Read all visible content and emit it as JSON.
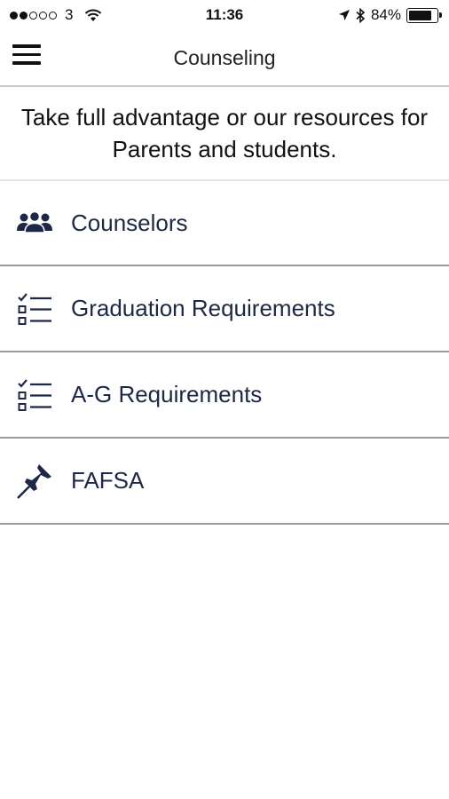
{
  "status_bar": {
    "carrier": "3",
    "time": "11:36",
    "battery": "84%",
    "battery_level": 0.84,
    "signal_bars_filled": 2,
    "signal_bars_total": 5
  },
  "nav": {
    "title": "Counseling",
    "menu_icon": "hamburger-icon"
  },
  "intro": {
    "text": "Take full advantage or our resources for Parents and students."
  },
  "items": [
    {
      "label": "Counselors",
      "icon": "people-group-icon"
    },
    {
      "label": "Graduation Requirements",
      "icon": "checklist-icon"
    },
    {
      "label": "A-G Requirements",
      "icon": "checklist-icon"
    },
    {
      "label": "FAFSA",
      "icon": "pushpin-icon"
    }
  ],
  "colors": {
    "text": "#1d2746",
    "icon": "#1d2746",
    "divider": "#9a9a9a"
  }
}
